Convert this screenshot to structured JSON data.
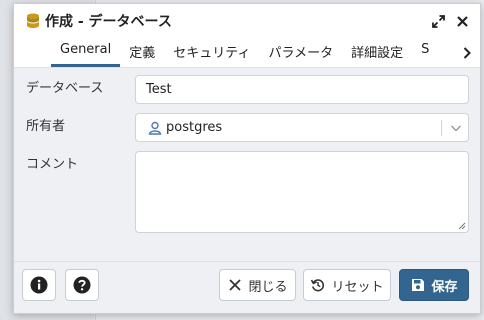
{
  "dialog": {
    "title": "作成 - データベース"
  },
  "tabs": [
    {
      "label": "General",
      "active": true
    },
    {
      "label": "定義"
    },
    {
      "label": "セキュリティ"
    },
    {
      "label": "パラメータ"
    },
    {
      "label": "詳細設定"
    },
    {
      "label": "S"
    }
  ],
  "form": {
    "database_label": "データベース",
    "database_value": "Test",
    "owner_label": "所有者",
    "owner_value": "postgres",
    "comment_label": "コメント",
    "comment_value": ""
  },
  "footer": {
    "close_label": "閉じる",
    "reset_label": "リセット",
    "save_label": "保存"
  },
  "colors": {
    "accent": "#326690",
    "body_bg": "#eef0f3"
  }
}
